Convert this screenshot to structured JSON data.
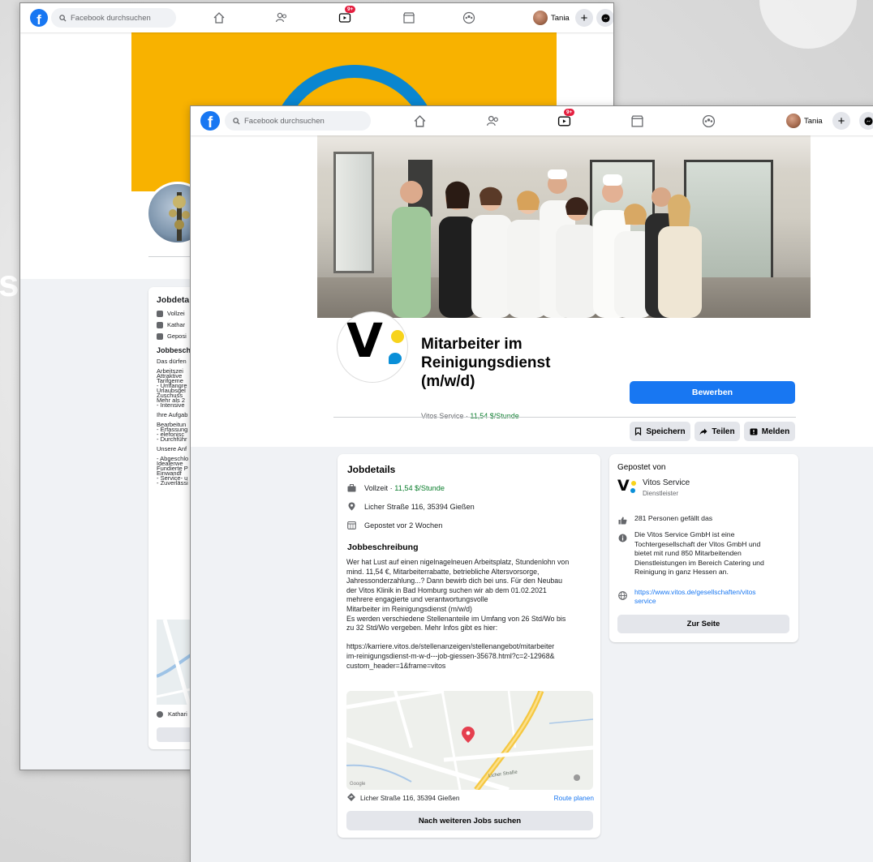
{
  "topbar": {
    "logo": "f",
    "search_placeholder": "Facebook durchsuchen",
    "notification_badge": "9+",
    "user_name": "Tania",
    "plus": "+"
  },
  "back_window": {
    "card_title": "Jobdeta",
    "rows": [
      "Vollzei",
      "Kathar",
      "Geposi"
    ],
    "section": "Jobbeschi",
    "lines": [
      "Das dürfen",
      "",
      "Arbeitszei",
      "Attraktive",
      "Tarifgeme",
      "- Umfangre",
      "Urlaubsgel",
      "Zuschuss",
      "Mehr als 2",
      "- Intensive",
      "",
      "Ihre Aufgab",
      "",
      "Bearbeitun",
      "- Erfassung",
      "- elefonisc",
      "- Durchführ",
      "",
      "Unsere Anf",
      "",
      "- Abgeschlo",
      "Idealerwe",
      "Fundierte P",
      "Einwandf",
      "- Service- u",
      "- Zuverlässi"
    ],
    "addr": "Kathari"
  },
  "job": {
    "title_lines": [
      "Mitarbeiter im",
      "Reinigungsdienst",
      "(m/w/d)"
    ],
    "company": "Vitos Service",
    "salary": "11,54 $/Stunde",
    "apply": "Bewerben",
    "save": "Speichern",
    "share": "Teilen",
    "report": "Melden"
  },
  "details": {
    "title": "Jobdetails",
    "type": "Vollzeit",
    "type_salary": "11,54 $/Stunde",
    "address": "Licher Straße 116, 35394 Gießen",
    "posted": "Gepostet vor 2 Wochen",
    "desc_title": "Jobbeschreibung",
    "desc_lines": [
      "Wer hat Lust auf einen nigelnagelneuen Arbeitsplatz, Stundenlohn von",
      "mind. 11,54 €, Mitarbeiterrabatte, betriebliche Altersvorsorge,",
      "Jahressonderzahlung...? Dann bewirb dich bei uns. Für den Neubau",
      "der Vitos Klinik in Bad Homburg suchen wir ab dem 01.02.2021",
      "mehrere engagierte und verantwortungsvolle",
      "Mitarbeiter im Reinigungsdienst (m/w/d)",
      "Es werden verschiedene Stellenanteile im Umfang von 26 Std/Wo bis",
      "zu 32 Std/Wo vergeben. Mehr Infos gibt es hier:",
      "",
      "https://karriere.vitos.de/stellenanzeigen/stellenangebot/mitarbeiter",
      "im-reinigungsdienst-m-w-d---job-giessen-35678.html?c=2-12968&",
      "custom_header=1&frame=vitos"
    ],
    "map_street": "Licher Straße",
    "map_attr": "Google",
    "addr_row": "Licher Straße 116, 35394 Gießen",
    "route": "Route planen",
    "more_jobs": "Nach weiteren Jobs suchen"
  },
  "side": {
    "title": "Gepostet von",
    "company": "Vitos Service",
    "category": "Dienstleister",
    "likes": "281 Personen gefällt das",
    "about_lines": [
      "Die Vitos Service GmbH ist eine",
      "Tochtergesellschaft der Vitos GmbH und",
      "bietet mit rund 850 Mitarbeitenden",
      "Dienstleistungen im Bereich Catering und",
      "Reinigung in ganz Hessen an."
    ],
    "url_lines": [
      "https://www.vitos.de/gesellschaften/vitos",
      "service"
    ],
    "page_btn": "Zur Seite"
  },
  "bg_letter": "s"
}
